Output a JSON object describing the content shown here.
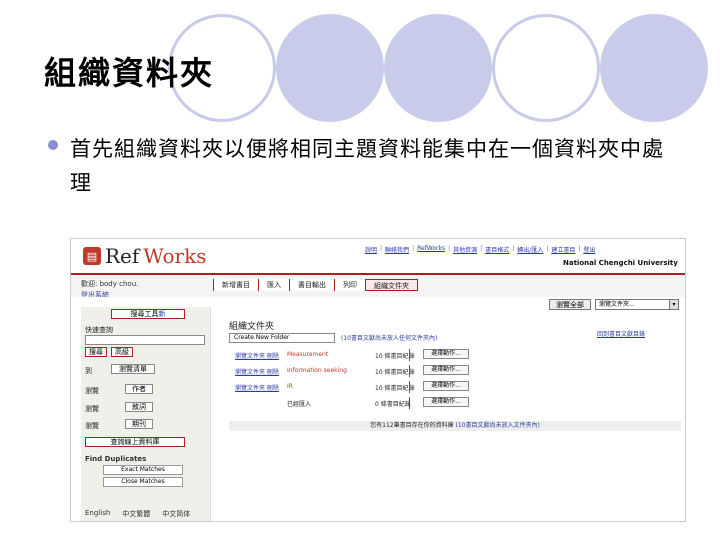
{
  "slide": {
    "title": "組織資料夾",
    "bullet": "首先組織資料夾以便將相同主題資料能集中在一個資料夾中處理"
  },
  "app": {
    "logo_icon": "▤",
    "logo_ref": "Ref",
    "logo_works": "Works",
    "top_links": [
      "說明",
      "聯絡我們",
      "RefWorks",
      "其他資源",
      "書目格式",
      "轉出/匯入",
      "建立書目",
      "登出"
    ],
    "university": "National Chengchi University",
    "user": "歡迎: body chou.",
    "logout": "登出系統",
    "menu": [
      "新增書目",
      "匯入",
      "書目輸出",
      "列印",
      "組織文件夾"
    ],
    "view_button": "瀏覽全部",
    "view_select": "瀏覽文件夾..."
  },
  "search_panel": {
    "header": "搜尋工具",
    "header_new": "新",
    "quick_search": "快速查詢",
    "btn_search": "搜尋",
    "btn_adv": "高級",
    "list_label": "到",
    "btn_list": "瀏覽清單",
    "filter_labels": [
      "瀏覽",
      "瀏覽",
      "瀏覽"
    ],
    "filter_buttons": [
      "作者",
      "敘詞",
      "期刊"
    ],
    "unfiled_btn": "查詢線上資料庫",
    "find_dup": "Find Duplicates",
    "exact": "Exact Matches",
    "close": "Close Matches",
    "langs": [
      "English",
      "中文繁體",
      "中文简体"
    ]
  },
  "folders": {
    "title": "組織文件夾",
    "back_link": "回到書目文獻目錄",
    "create": "Create New Folder",
    "unfiled_note": "(10書目文獻尚未放入任何文件夾內)",
    "rows": [
      {
        "links": "瀏覽文件夾  刪除",
        "name": "Measurement",
        "count": "10 條書目紀錄",
        "action": "選擇動作..."
      },
      {
        "links": "瀏覽文件夾  刪除",
        "name": "Information seeking",
        "count": "10 條書目紀錄",
        "action": "選擇動作..."
      },
      {
        "links": "瀏覽文件夾  刪除",
        "name": "IR",
        "count": "10 條書目紀錄",
        "action": "選擇動作..."
      },
      {
        "links": "",
        "name": "已經匯入",
        "count": "0 條書目紀錄",
        "action": "選擇動作..."
      }
    ],
    "footer": "您有112筆書目存在你的資料庫",
    "footer_link": "(10書目文獻尚未放入文件夾內)"
  }
}
